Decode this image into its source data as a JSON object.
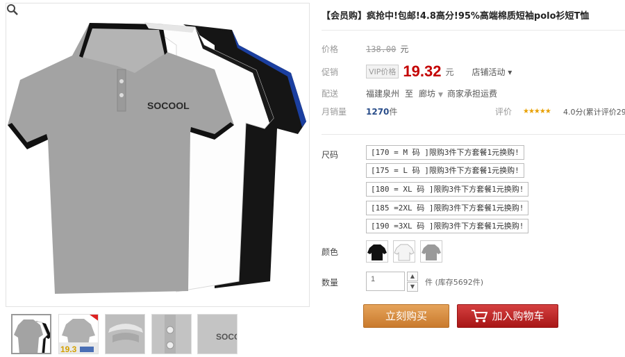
{
  "product": {
    "title": "【会员购】疯抢中!包邮!4.8高分!95%高端棉质短袖polo衫短T恤",
    "logo_text": "SOCOOL"
  },
  "price": {
    "label": "价格",
    "original": "138.00",
    "unit": "元"
  },
  "promo": {
    "label": "促销",
    "vip_tag": "VIP价格",
    "price": "19.32",
    "unit": "元",
    "activity": "店铺活动 ▾"
  },
  "shipping": {
    "label": "配送",
    "from": "福建泉州",
    "to_word": "至",
    "dest": "廊坊",
    "fee": "商家承担运费"
  },
  "sales": {
    "label": "月销量",
    "count": "1270",
    "unit": "件",
    "rating_label": "评价",
    "stars": "★★★★★",
    "rating_text": "4.0分(累计评价29"
  },
  "sizes": {
    "label": "尺码",
    "options": [
      "[170 = M 码 ]限购3件下方套餐1元换购!",
      "[175 = L 码 ]限购3件下方套餐1元换购!",
      "[180 = XL 码 ]限购3件下方套餐1元换购!",
      "[185 =2XL 码 ]限购3件下方套餐1元换购!",
      "[190 =3XL 码 ]限购3件下方套餐1元换购!"
    ]
  },
  "colors": {
    "label": "颜色",
    "swatches": [
      {
        "name": "black",
        "hex": "#111111"
      },
      {
        "name": "white",
        "hex": "#f4f4f4"
      },
      {
        "name": "gray",
        "hex": "#9a9a9a"
      }
    ]
  },
  "quantity": {
    "label": "数量",
    "value": "1",
    "stock": "件 (库存5692件)"
  },
  "buttons": {
    "buy_now": "立刻购买",
    "add_cart": "加入购物车"
  },
  "thumbs": {
    "price_badge": "19.3"
  },
  "colors_theme": {
    "price_red": "#c40000",
    "buy_orange": "#d18a3c",
    "cart_red": "#b51d1d",
    "link_blue": "#2a4e8a"
  }
}
